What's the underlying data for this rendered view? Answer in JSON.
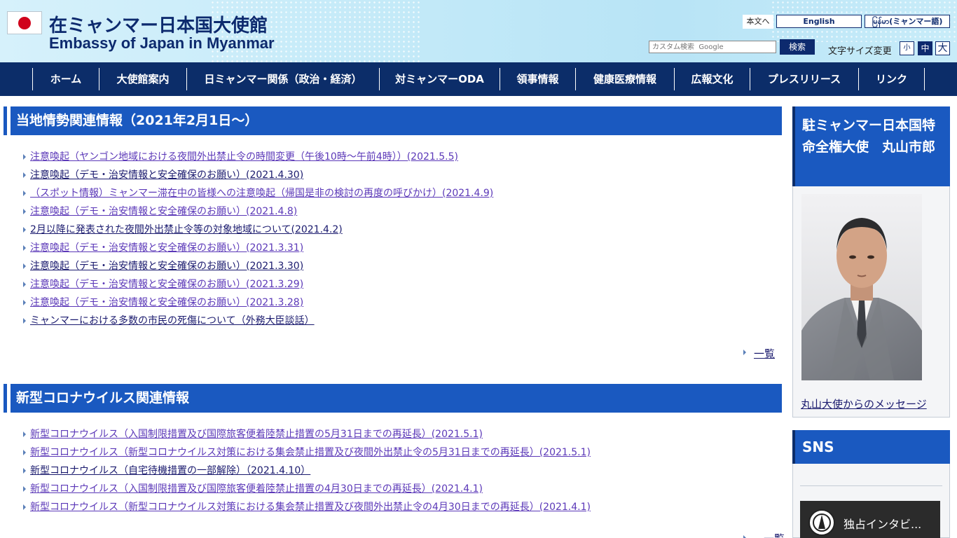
{
  "header": {
    "title_ja": "在ミャンマー日本国大使館",
    "title_en": "Embassy of Japan in Myanmar",
    "skip_link": "本文へ",
    "lang_en": "English",
    "lang_my": "မြန်မာ(ミャンマー語)",
    "search_placeholder": "カスタム検索  Google",
    "search_button": "検索",
    "font_size_label": "文字サイズ変更",
    "font_small": "小",
    "font_medium": "中",
    "font_large": "大"
  },
  "nav": [
    "ホーム",
    "大使館案内",
    "日ミャンマー関係（政治・経済）",
    "対ミャンマーODA",
    "領事情報",
    "健康医療情報",
    "広報文化",
    "プレスリリース",
    "リンク"
  ],
  "section_local": {
    "title": "当地情勢関連情報（2021年2月1日～）",
    "items": [
      "注意喚起（ヤンゴン地域における夜間外出禁止令の時間変更（午後10時～午前4時））(2021.5.5)",
      "注意喚起（デモ・治安情報と安全確保のお願い）(2021.4.30)",
      "（スポット情報）ミャンマー滞在中の皆様への注意喚起（帰国是非の検討の再度の呼びかけ）(2021.4.9)",
      "注意喚起（デモ・治安情報と安全確保のお願い）(2021.4.8)",
      "2月以降に発表された夜間外出禁止令等の対象地域について(2021.4.2)",
      "注意喚起（デモ・治安情報と安全確保のお願い）(2021.3.31)",
      "注意喚起（デモ・治安情報と安全確保のお願い）(2021.3.30)",
      "注意喚起（デモ・治安情報と安全確保のお願い）(2021.3.29)",
      "注意喚起（デモ・治安情報と安全確保のお願い）(2021.3.28)",
      "ミャンマーにおける多数の市民の死傷について（外務大臣談話）"
    ],
    "more": "一覧"
  },
  "section_covid": {
    "title": "新型コロナウイルス関連情報",
    "items": [
      "新型コロナウイルス（入国制限措置及び国際旅客便着陸禁止措置の5月31日までの再延長）(2021.5.1)",
      "新型コロナウイルス（新型コロナウイルス対策における集会禁止措置及び夜間外出禁止令の5月31日までの再延長）(2021.5.1)",
      "新型コロナウイルス（自宅待機措置の一部解除）（2021.4.10）",
      "新型コロナウイルス（入国制限措置及び国際旅客便着陸禁止措置の4月30日までの再延長）(2021.4.1)",
      "新型コロナウイルス（新型コロナウイルス対策における集会禁止措置及び夜間外出禁止令の4月30日までの再延長）(2021.4.1)"
    ],
    "more": "一覧"
  },
  "sidebar": {
    "ambassador_title": "駐ミャンマー日本国特命全権大使　丸山市郎",
    "ambassador_link": "丸山大使からのメッセージ",
    "sns_title": "SNS",
    "video_title": "独占インタビ..."
  },
  "colors": {
    "navy": "#0c2d69",
    "section_blue": "#1a59c0",
    "link": "#1a1a6e",
    "visited": "#5b38b8"
  }
}
